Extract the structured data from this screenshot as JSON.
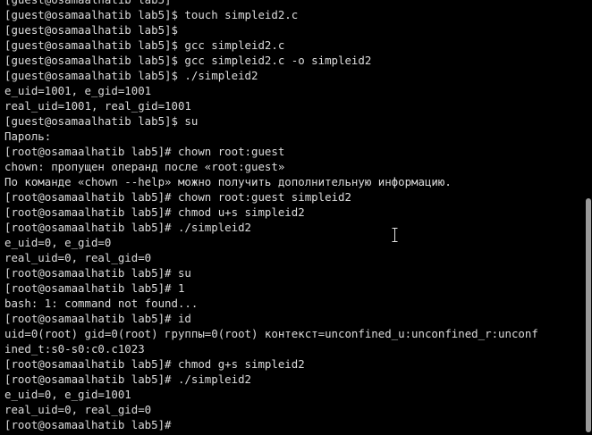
{
  "terminal": {
    "lines": [
      "[guest@osamaalhatib lab5]",
      "[guest@osamaalhatib lab5]$ touch simpleid2.c",
      "[guest@osamaalhatib lab5]$",
      "[guest@osamaalhatib lab5]$ gcc simpleid2.c",
      "[guest@osamaalhatib lab5]$ gcc simpleid2.c -o simpleid2",
      "[guest@osamaalhatib lab5]$ ./simpleid2",
      "e_uid=1001, e_gid=1001",
      "real_uid=1001, real_gid=1001",
      "[guest@osamaalhatib lab5]$ su",
      "Пароль:",
      "[root@osamaalhatib lab5]# chown root:guest",
      "chown: пропущен операнд после «root:guest»",
      "По команде «chown --help» можно получить дополнительную информацию.",
      "[root@osamaalhatib lab5]# chown root:guest simpleid2",
      "[root@osamaalhatib lab5]# chmod u+s simpleid2",
      "[root@osamaalhatib lab5]# ./simpleid2",
      "e_uid=0, e_gid=0",
      "real_uid=0, real_gid=0",
      "[root@osamaalhatib lab5]# su",
      "[root@osamaalhatib lab5]# 1",
      "bash: 1: command not found...",
      "[root@osamaalhatib lab5]# id",
      "uid=0(root) gid=0(root) группы=0(root) контекст=unconfined_u:unconfined_r:unconf",
      "ined_t:s0-s0:c0.c1023",
      "[root@osamaalhatib lab5]# chmod g+s simpleid2",
      "[root@osamaalhatib lab5]# ./simpleid2",
      "e_uid=0, e_gid=1001",
      "real_uid=0, real_gid=0",
      "[root@osamaalhatib lab5]#"
    ]
  },
  "colors": {
    "background": "#000000",
    "foreground": "#dcdcdc",
    "scrollbar_thumb": "#9a9a9a",
    "cursor": "#e6e6e6"
  },
  "icons": {
    "text_cursor": "i-beam-cursor-icon"
  }
}
